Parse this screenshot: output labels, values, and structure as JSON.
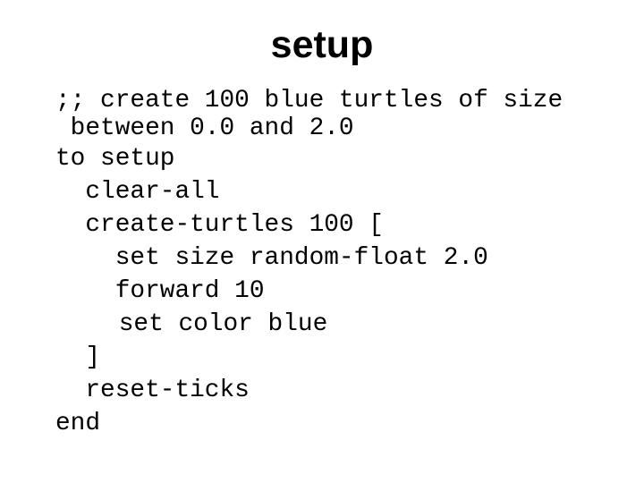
{
  "slide": {
    "title": "setup",
    "code_lines": [
      ";; create 100 blue turtles of size",
      " between 0.0 and 2.0",
      "to setup",
      "  clear-all",
      "  create-turtles 100 [",
      "    set size random-float 2.0",
      "    forward 10",
      "    set color blue",
      "  ]",
      "  reset-ticks",
      "end"
    ]
  }
}
